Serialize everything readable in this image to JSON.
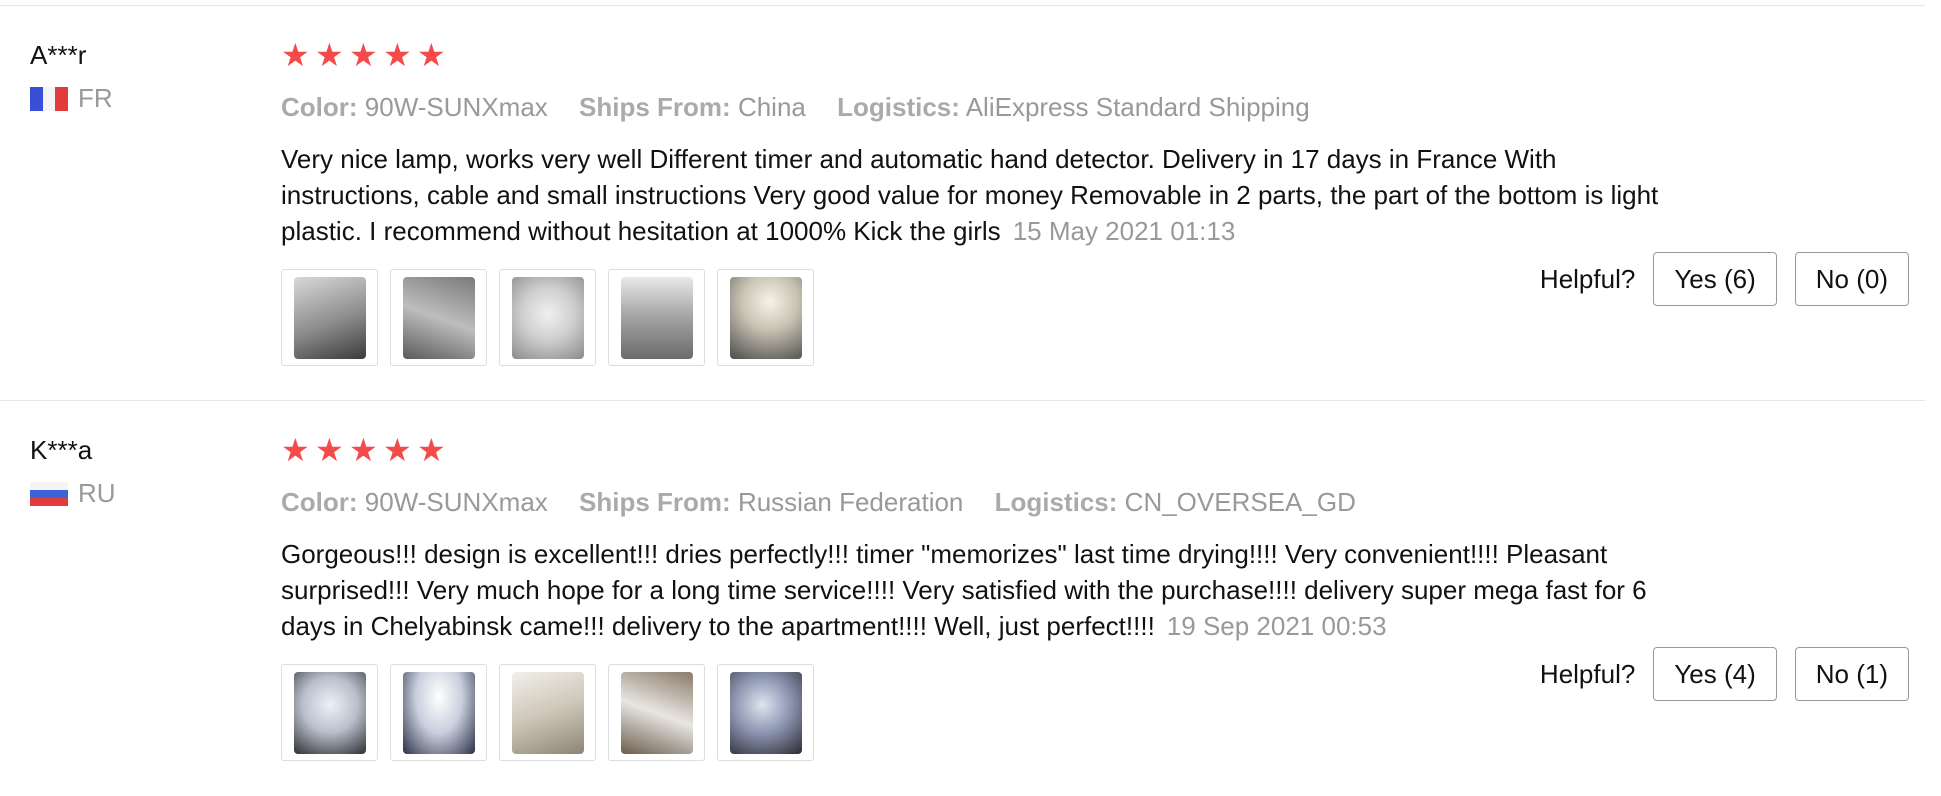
{
  "colors": {
    "star": "#f44a4a",
    "meta_gray": "#999999",
    "divider": "#e6e6e6"
  },
  "reviews": [
    {
      "user": {
        "name": "A***r",
        "country": "FR",
        "flag_icon": "france-flag-icon"
      },
      "rating": 5,
      "meta": {
        "color_label": "Color:",
        "color_value": "90W-SUNXmax",
        "ships_label": "Ships From:",
        "ships_value": "China",
        "logistics_label": "Logistics:",
        "logistics_value": "AliExpress Standard Shipping"
      },
      "text": "Very nice lamp, works very well Different timer and automatic hand detector. Delivery in 17 days in France With instructions, cable and small instructions Very good value for money Removable in 2 parts, the part of the bottom is light plastic. I recommend without hesitation at 1000% Kick the girls",
      "date": "15 May 2021 01:13",
      "photos": 5,
      "helpful": {
        "label": "Helpful?",
        "yes": "Yes (6)",
        "no": "No (0)"
      }
    },
    {
      "user": {
        "name": "K***a",
        "country": "RU",
        "flag_icon": "russia-flag-icon"
      },
      "rating": 5,
      "meta": {
        "color_label": "Color:",
        "color_value": "90W-SUNXmax",
        "ships_label": "Ships From:",
        "ships_value": "Russian Federation",
        "logistics_label": "Logistics:",
        "logistics_value": "CN_OVERSEA_GD"
      },
      "text": "Gorgeous!!! design is excellent!!! dries perfectly!!! timer \"memorizes\" last time drying!!!! Very convenient!!!! Pleasant surprised!!! Very much hope for a long time service!!!! Very satisfied with the purchase!!!! delivery super mega fast for 6 days in Chelyabinsk came!!! delivery to the apartment!!!! Well, just perfect!!!!",
      "date": "19 Sep 2021 00:53",
      "photos": 5,
      "helpful": {
        "label": "Helpful?",
        "yes": "Yes (4)",
        "no": "No (1)"
      }
    }
  ]
}
